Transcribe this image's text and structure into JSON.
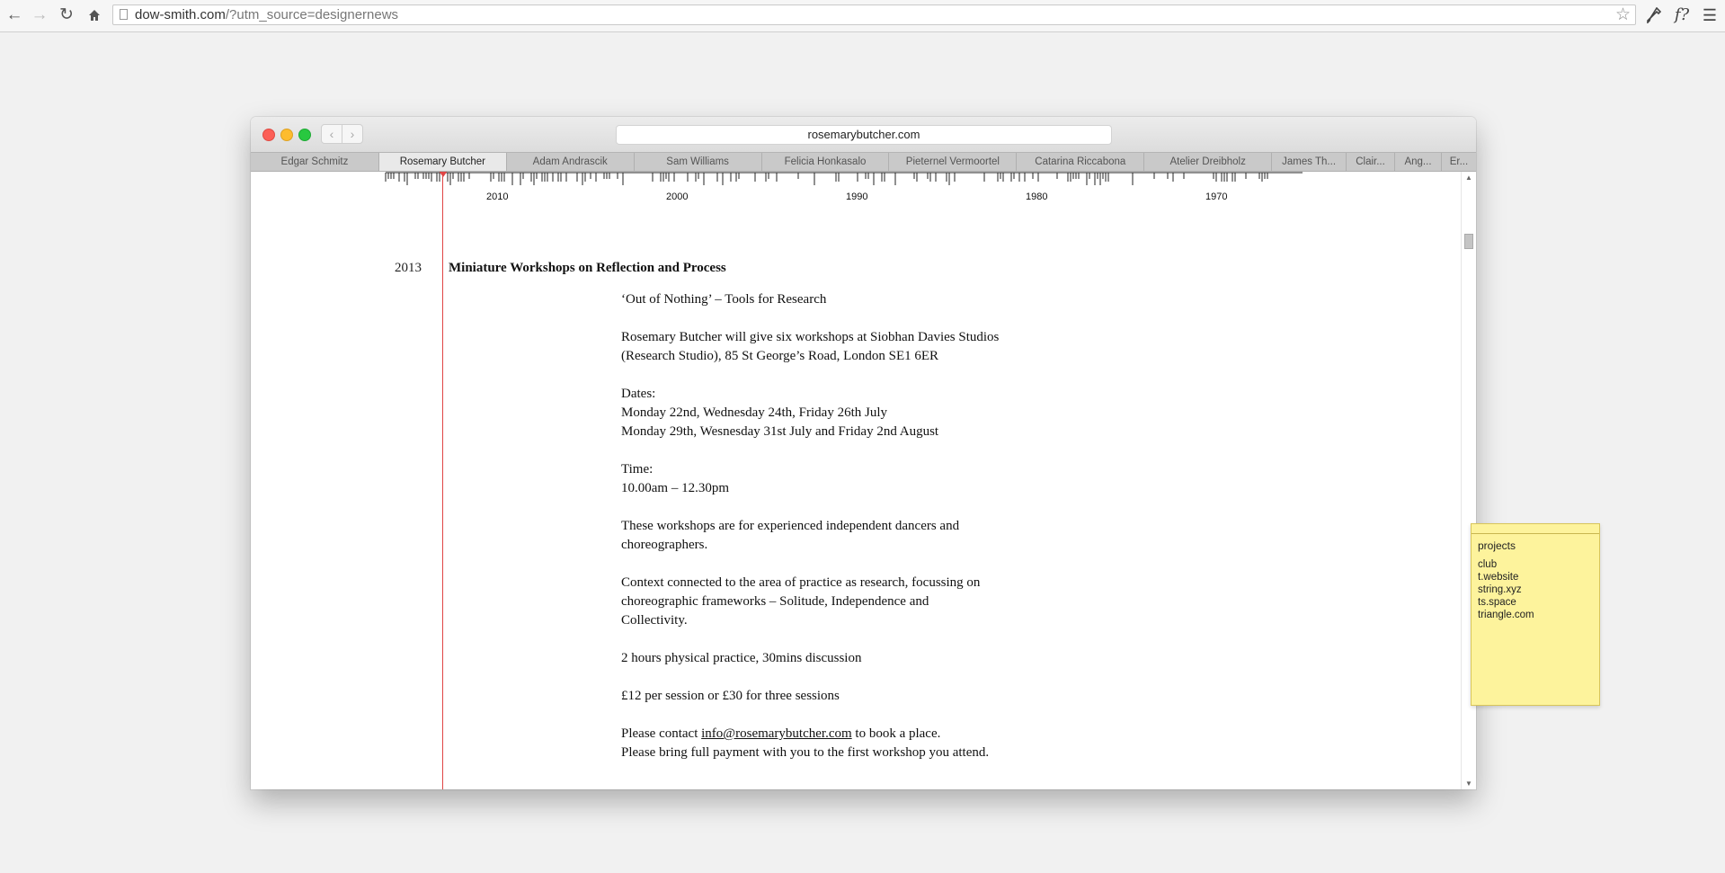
{
  "browser": {
    "url": "dow-smith.com",
    "url_rest": "/?utm_source=designernews",
    "extension_icons": [
      "?"
    ]
  },
  "mock_window": {
    "url": "rosemarybutcher.com",
    "tabs": [
      {
        "label": "Edgar Schmitz"
      },
      {
        "label": "Rosemary Butcher",
        "active": true
      },
      {
        "label": "Adam Andrascik"
      },
      {
        "label": "Sam Williams"
      },
      {
        "label": "Felicia Honkasalo"
      },
      {
        "label": "Pieternel Vermoortel"
      },
      {
        "label": "Catarina Riccabona"
      },
      {
        "label": "Atelier Dreibholz"
      },
      {
        "label": "James Th..."
      },
      {
        "label": "Clair..."
      },
      {
        "label": "Ang..."
      },
      {
        "label": "Er..."
      }
    ]
  },
  "timeline": {
    "year_labels": [
      "2010",
      "2000",
      "1990",
      "1980",
      "1970"
    ]
  },
  "entry": {
    "year": "2013",
    "title": "Miniature Workshops on Reflection and Process",
    "subtitle": "‘Out of Nothing’ – Tools for Research",
    "intro_1": "Rosemary Butcher will give six workshops at Siobhan Davies Studios",
    "intro_2": "(Research Studio), 85 St George’s Road, London SE1 6ER",
    "dates_label": "Dates:",
    "dates_1": "Monday 22nd, Wednesday 24th, Friday 26th July",
    "dates_2": "Monday 29th, Wesnesday 31st July and Friday 2nd August",
    "time_label": "Time:",
    "time_value": "10.00am – 12.30pm",
    "audience_1": "These workshops are for experienced independent dancers and",
    "audience_2": "choreographers.",
    "context_1": "Context connected to the area of practice as research, focussing on",
    "context_2": "choreographic frameworks – Solitude, Independence and",
    "context_3": "Collectivity.",
    "format": "2 hours physical practice, 30mins discussion",
    "price": "£12 per session or £30 for three sessions",
    "contact_pre": "Please contact ",
    "contact_email": "info@rosemarybutcher.com",
    "contact_post": " to book a place.",
    "payment": "Please bring full payment with you to the first workshop you attend."
  },
  "sticky_note": {
    "title": "projects",
    "items": [
      "club",
      "t.website",
      "string.xyz",
      "ts.space",
      "triangle.com"
    ]
  }
}
